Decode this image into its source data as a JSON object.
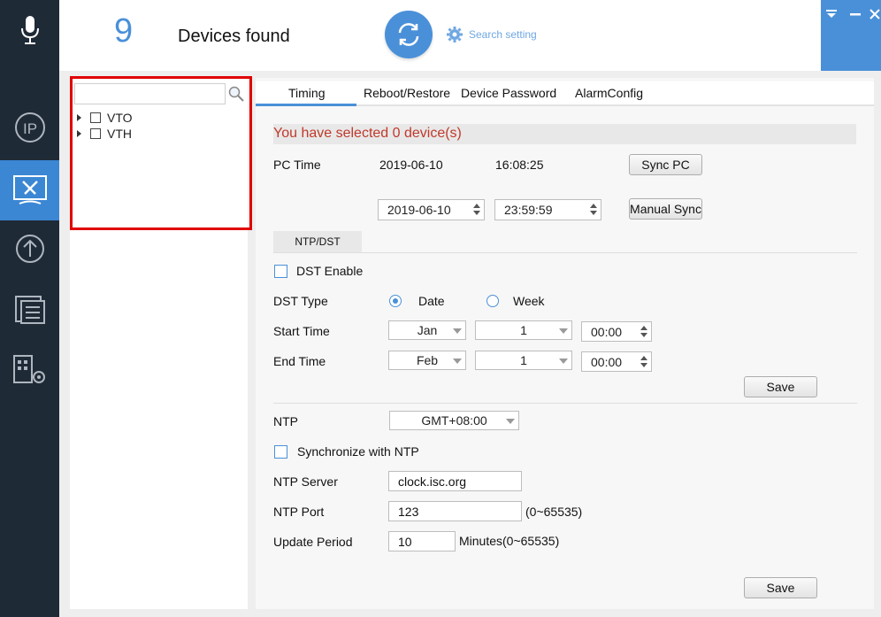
{
  "header": {
    "device_count": "9",
    "devices_found": "Devices found",
    "search_setting": "Search setting"
  },
  "nav": {
    "items": [
      {
        "icon": "microphone-icon"
      },
      {
        "icon": "ip-config-icon"
      },
      {
        "icon": "system-settings-icon",
        "active": true
      },
      {
        "icon": "upgrade-icon"
      },
      {
        "icon": "device-list-icon"
      },
      {
        "icon": "building-settings-icon"
      }
    ]
  },
  "tree": {
    "search_value": "",
    "items": [
      {
        "label": "VTO"
      },
      {
        "label": "VTH"
      }
    ]
  },
  "tabs": [
    {
      "label": "Timing",
      "active": true
    },
    {
      "label": "Reboot/Restore"
    },
    {
      "label": "Device Password"
    },
    {
      "label": "AlarmConfig"
    }
  ],
  "timing": {
    "selected_message": "You have selected 0 device(s)",
    "pc_time_label": "PC Time",
    "pc_date": "2019-06-10",
    "pc_time": "16:08:25",
    "sync_pc": "Sync PC",
    "manual_date": "2019-06-10",
    "manual_time": "23:59:59",
    "manual_sync": "Manual Sync",
    "subtab": "NTP/DST",
    "dst_enable": "DST Enable",
    "dst_type_label": "DST Type",
    "dst_type_date": "Date",
    "dst_type_week": "Week",
    "start_time_label": "Start Time",
    "start_month": "Jan",
    "start_day": "1",
    "start_hm": "00:00",
    "end_time_label": "End Time",
    "end_month": "Feb",
    "end_day": "1",
    "end_hm": "00:00",
    "save": "Save",
    "ntp_label": "NTP",
    "ntp_timezone": "GMT+08:00",
    "sync_ntp": "Synchronize with NTP",
    "ntp_server_label": "NTP Server",
    "ntp_server": "clock.isc.org",
    "ntp_port_label": "NTP Port",
    "ntp_port": "123",
    "ntp_port_range": "(0~65535)",
    "update_period_label": "Update Period",
    "update_period": "10",
    "update_period_unit": "Minutes(0~65535)",
    "save2": "Save"
  },
  "colors": {
    "accent": "#4a90d9",
    "nav_bg": "#1f2a37",
    "warning_text": "#c0392b",
    "highlight_border": "#e00000"
  }
}
